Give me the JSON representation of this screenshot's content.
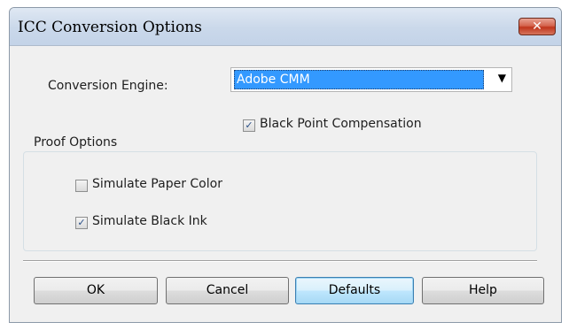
{
  "dialog": {
    "title": "ICC Conversion Options",
    "close_label": "✕"
  },
  "engine": {
    "label": "Conversion Engine:",
    "selected": "Adobe CMM",
    "arrow": "▼"
  },
  "black_point": {
    "label": "Black Point Compensation",
    "checked": true
  },
  "proof_options": {
    "title": "Proof Options",
    "simulate_paper": {
      "label": "Simulate Paper Color",
      "checked": false
    },
    "simulate_ink": {
      "label": "Simulate Black Ink",
      "checked": true
    }
  },
  "buttons": {
    "ok": "OK",
    "cancel": "Cancel",
    "defaults": "Defaults",
    "help": "Help"
  },
  "checkmark": "✓"
}
